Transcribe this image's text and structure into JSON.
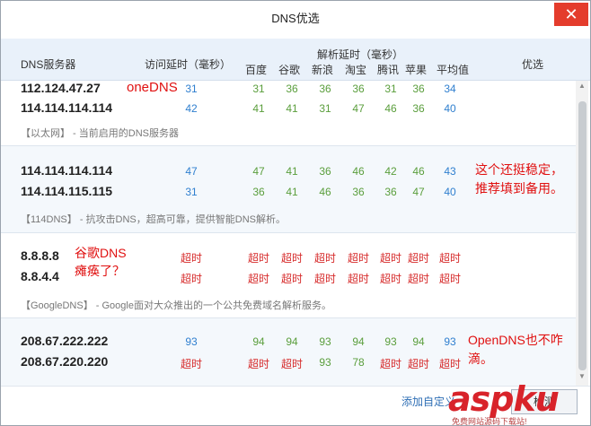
{
  "window": {
    "title": "DNS优选",
    "close_glyph": "✕"
  },
  "header": {
    "dns_server": "DNS服务器",
    "access_latency": "访问延时（毫秒）",
    "resolve_latency": "解析延时（毫秒）",
    "sites": [
      "百度",
      "谷歌",
      "新浪",
      "淘宝",
      "腾讯",
      "苹果",
      "平均值"
    ],
    "optimize": "优选"
  },
  "groups": [
    {
      "servers": [
        {
          "ip": "112.124.47.27",
          "access": "31",
          "resolve": [
            "31",
            "36",
            "36",
            "36",
            "31",
            "36",
            "34"
          ]
        },
        {
          "ip": "114.114.114.114",
          "access": "42",
          "resolve": [
            "41",
            "41",
            "31",
            "47",
            "46",
            "36",
            "40"
          ]
        }
      ],
      "description": "【以太网】 - 当前启用的DNS服务器",
      "annotation": "oneDNS"
    },
    {
      "servers": [
        {
          "ip": "114.114.114.114",
          "access": "47",
          "resolve": [
            "47",
            "41",
            "36",
            "46",
            "42",
            "46",
            "43"
          ]
        },
        {
          "ip": "114.114.115.115",
          "access": "31",
          "resolve": [
            "36",
            "41",
            "46",
            "36",
            "36",
            "47",
            "40"
          ]
        }
      ],
      "description": "【114DNS】 - 抗攻击DNS，超高可靠，提供智能DNS解析。",
      "annotation": [
        "这个还挺稳定，",
        "推荐填到备用。"
      ]
    },
    {
      "servers": [
        {
          "ip": "8.8.8.8",
          "access": "超时",
          "resolve": [
            "超时",
            "超时",
            "超时",
            "超时",
            "超时",
            "超时",
            "超时"
          ]
        },
        {
          "ip": "8.8.4.4",
          "access": "超时",
          "resolve": [
            "超时",
            "超时",
            "超时",
            "超时",
            "超时",
            "超时",
            "超时"
          ]
        }
      ],
      "description": "【GoogleDNS】 - Google面对大众推出的一个公共免费域名解析服务。",
      "annotation": [
        "谷歌DNS",
        "瘫痪了？"
      ]
    },
    {
      "servers": [
        {
          "ip": "208.67.222.222",
          "access": "93",
          "resolve": [
            "94",
            "94",
            "93",
            "94",
            "93",
            "94",
            "93"
          ]
        },
        {
          "ip": "208.67.220.220",
          "access": "超时",
          "resolve": [
            "超时",
            "超时",
            "93",
            "78",
            "超时",
            "超时",
            "超时"
          ]
        }
      ],
      "annotation": [
        "OpenDNS也不咋",
        "滴。"
      ]
    }
  ],
  "footer": {
    "add_custom": "添加自定义",
    "action_button": "检测"
  },
  "watermark": {
    "logo": "aspku",
    "tagline": "免费网站源码下载站!"
  },
  "colors": {
    "fast": "#2f7fcf",
    "normal": "#5a9e3c",
    "timeout": "#d62a2a",
    "annotation": "#e01010",
    "close": "#e43c2c"
  }
}
